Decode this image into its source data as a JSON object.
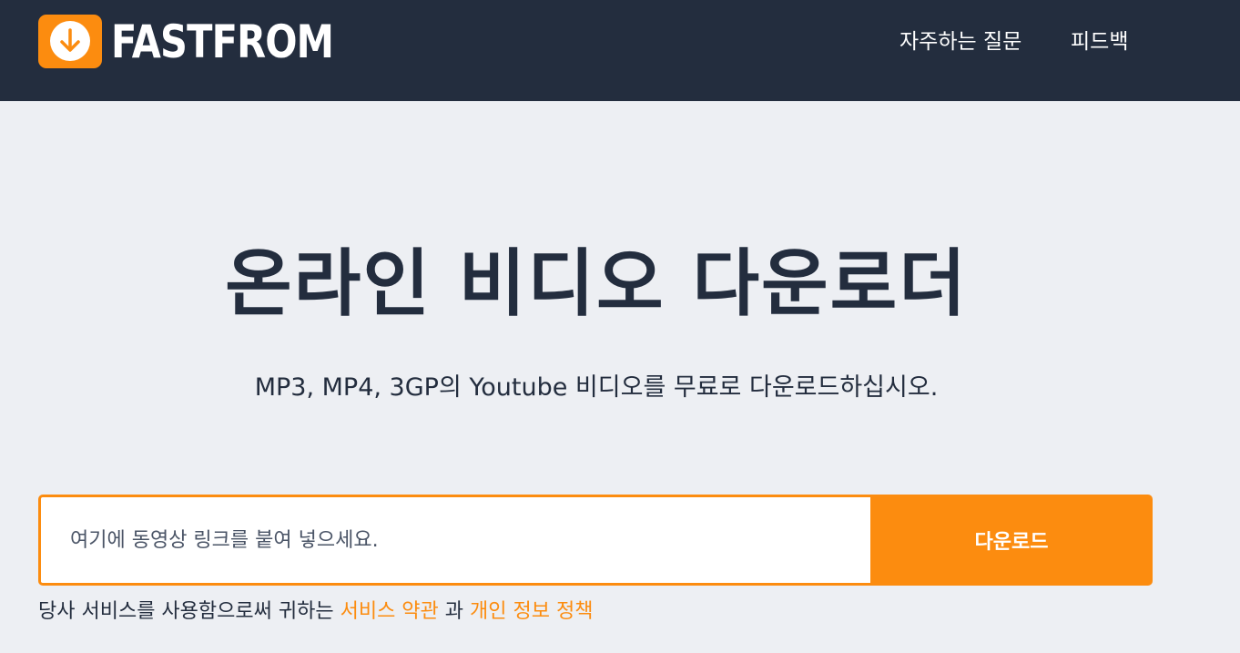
{
  "brand": {
    "name": "FASTFROM",
    "logo_icon": "download-arrow-icon",
    "accent_color": "#fc8c0f",
    "nav_color": "#232d3e"
  },
  "nav": {
    "faq": "자주하는 질문",
    "feedback": "피드백"
  },
  "hero": {
    "title": "온라인 비디오 다운로더",
    "subtitle": "MP3, MP4, 3GP의 Youtube 비디오를 무료로 다운로드하십시오."
  },
  "form": {
    "placeholder": "여기에 동영상 링크를 붙여 넣으세요.",
    "value": "",
    "button": "다운로드"
  },
  "terms": {
    "prefix": "당사 서비스를 사용함으로써 귀하는",
    "terms_link": "서비스 약관",
    "conjunction": "과",
    "privacy_link": "개인 정보 정책"
  }
}
